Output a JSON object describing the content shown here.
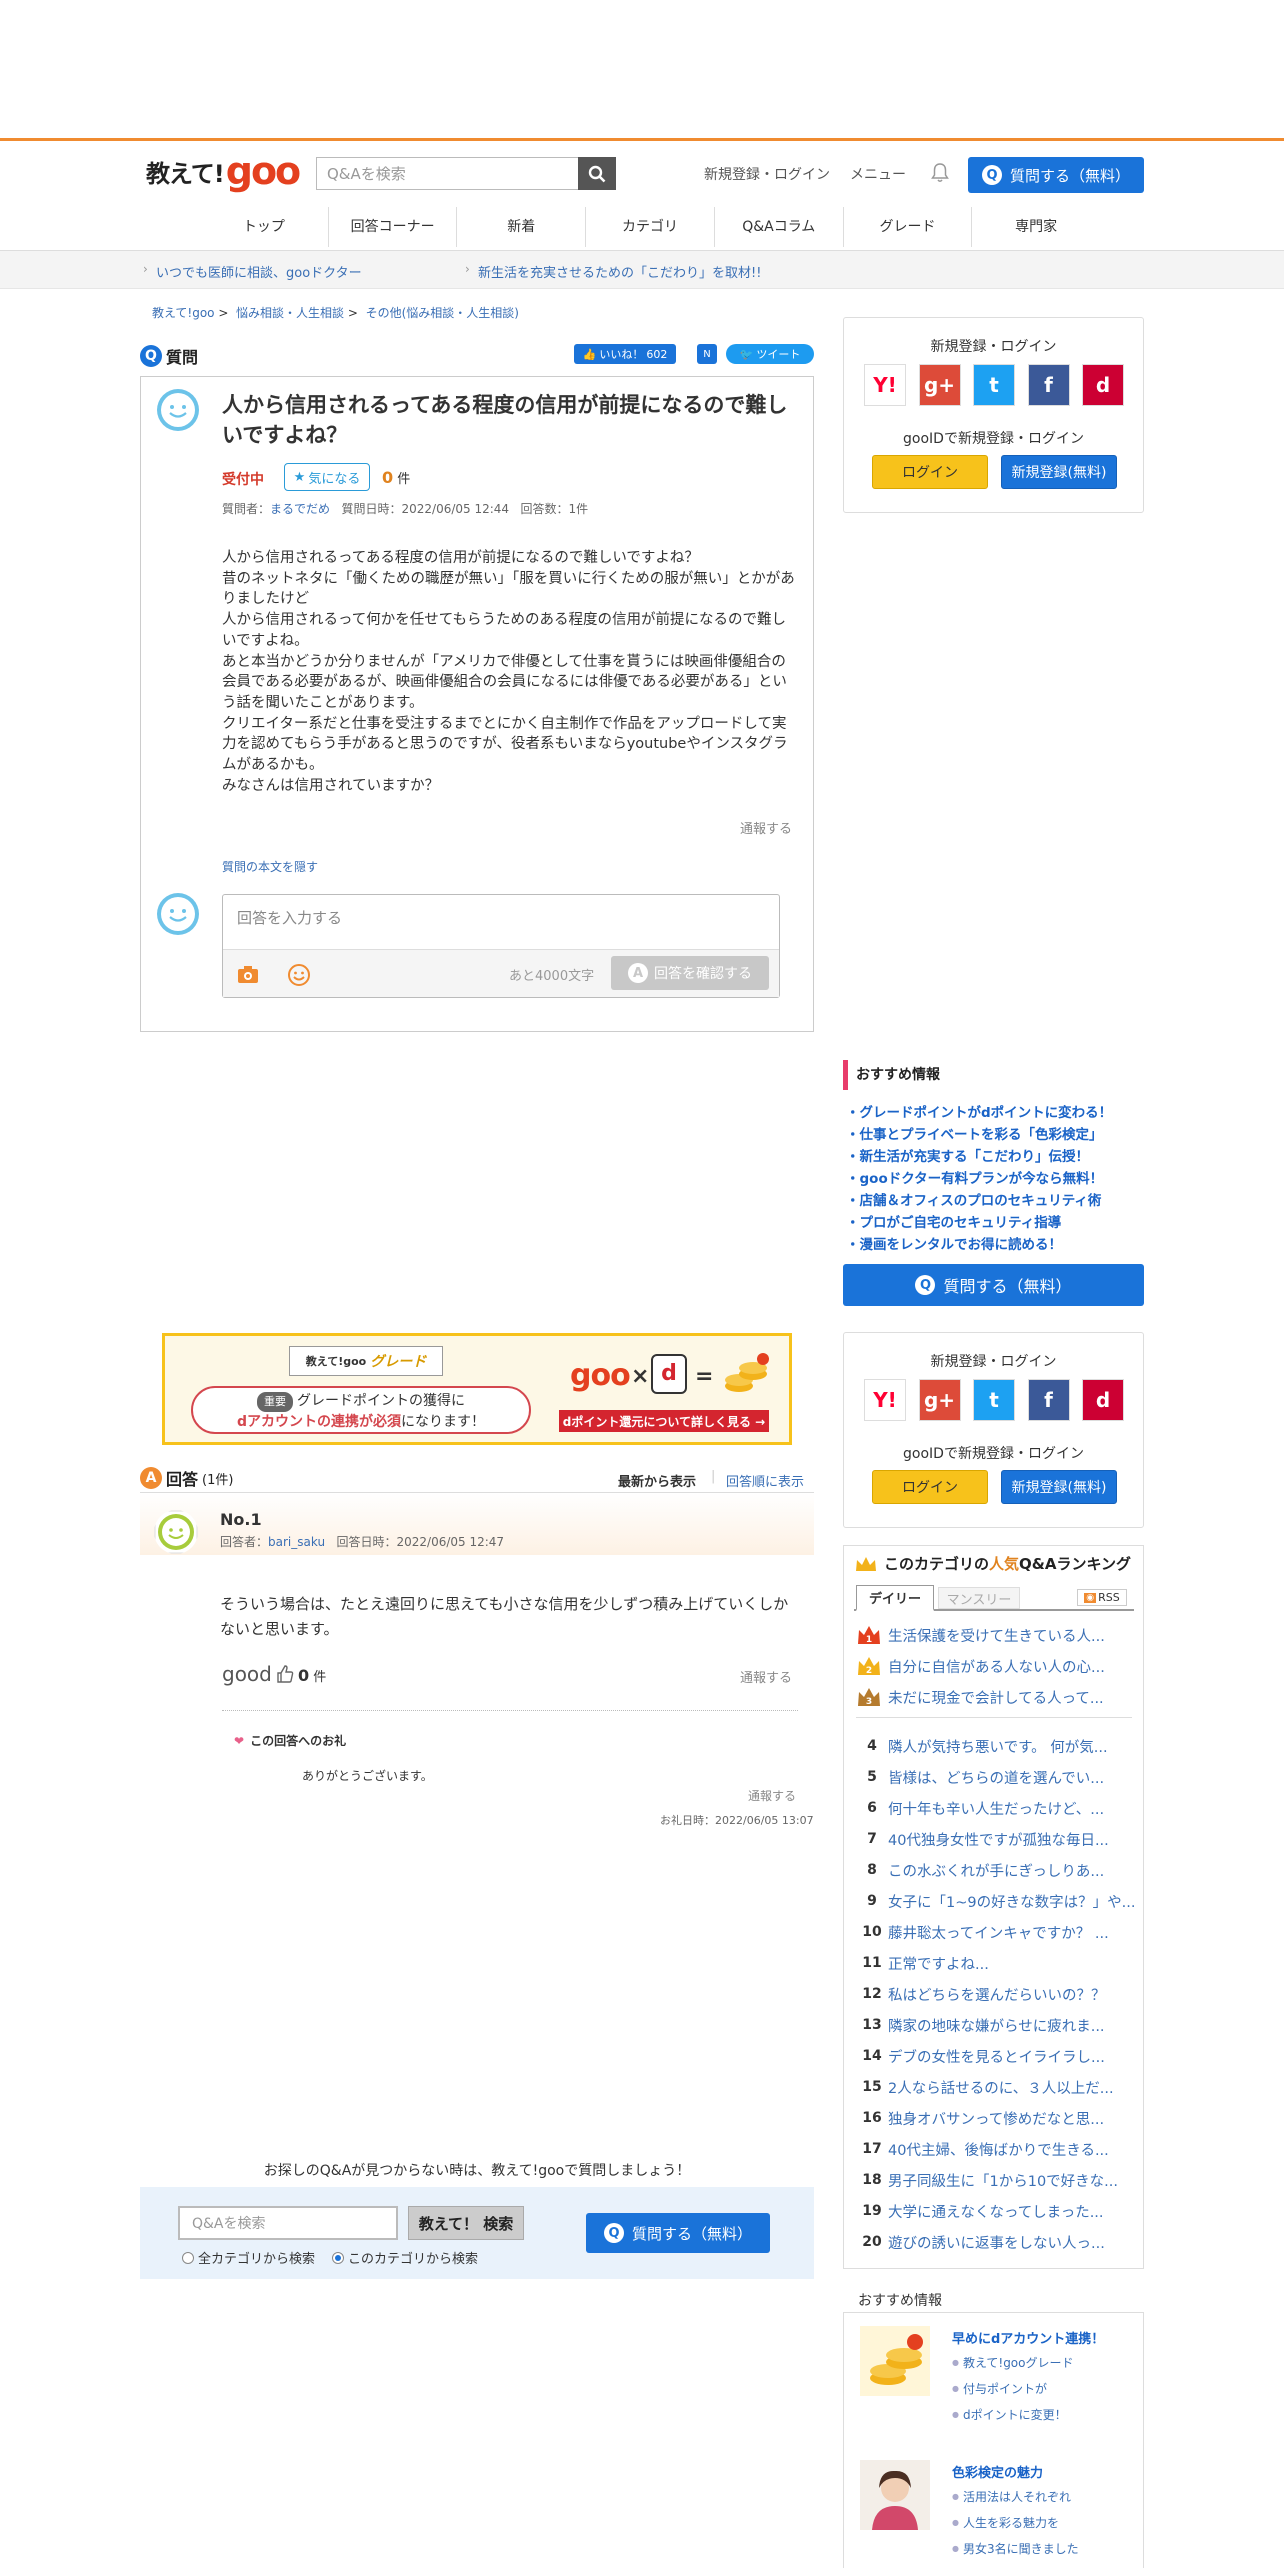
{
  "header": {
    "logo_text_1": "教えて!",
    "logo_text_2": "goo",
    "search_placeholder": "Q&Aを検索",
    "register_login": "新規登録・ログイン",
    "menu": "メニュー",
    "ask_button": "質問する（無料）",
    "ask_q": "Q"
  },
  "nav": {
    "items": [
      "トップ",
      "回答コーナー",
      "新着",
      "カテゴリ",
      "Q&Aコラム",
      "グレード",
      "専門家"
    ]
  },
  "subbar": {
    "link1": "いつでも医師に相談、gooドクター",
    "link2": "新生活を充実させるための「こだわり」を取材!!"
  },
  "breadcrumb": {
    "items": [
      "教えて!goo",
      "悩み相談・人生相談",
      "その他(悩み相談・人生相談)"
    ],
    "sep": ">"
  },
  "question": {
    "section_label": "質問",
    "like_label": "いいね！",
    "like_count": "602",
    "note_label": "N",
    "tweet_label": "ツイート",
    "title": "人から信用されるってある程度の信用が前提になるので難しいですよね？",
    "status": "受付中",
    "follow_label": "気になる",
    "count_value": "0",
    "count_unit": "件",
    "asker_label": "質問者：",
    "asker_name": "まるでだめ",
    "date_label": "質問日時：2022/06/05 12:44",
    "answers_label": "回答数：1件",
    "body": "人から信用されるってある程度の信用が前提になるので難しいですよね？\n昔のネットネタに「働くための職歴が無い」「服を買いに行くための服が無い」とかがありましたけど\n人から信用されるって何かを任せてもらうためのある程度の信用が前提になるので難しいですよね。\nあと本当かどうか分りませんが「アメリカで俳優として仕事を貰うには映画俳優組合の会員である必要があるが、映画俳優組合の会員になるには俳優である必要がある」という話を聞いたことがあります。\nクリエイター系だと仕事を受注するまでとにかく自主制作で作品をアップロードして実力を認めてもらう手があると思うのですが、役者系もいまならyoutubeやインスタグラムがあるかも。\nみなさんは信用されていますか？",
    "report": "通報する",
    "hide_body": "質問の本文を隠す",
    "answer_placeholder": "回答を入力する",
    "remaining": "あと4000文字",
    "confirm_button": "回答を確認する",
    "confirm_a": "A"
  },
  "sidebar": {
    "login_title": "新規登録・ログイン",
    "social": [
      {
        "label": "Y!",
        "color": "#ff0033"
      },
      {
        "label": "g+",
        "color": "#dd4b39"
      },
      {
        "label": "t",
        "color": "#1da1f2"
      },
      {
        "label": "f",
        "color": "#3b5998"
      },
      {
        "label": "d",
        "color": "#cc0033"
      }
    ],
    "gooid_text": "gooIDで新規登録・ログイン",
    "login_button": "ログイン",
    "register_button": "新規登録(無料)",
    "recommend_title": "おすすめ情報",
    "recommend": [
      "グレードポイントがdポイントに変わる！",
      "仕事とプライベートを彩る「色彩検定」",
      "新生活が充実する「こだわり」伝授！",
      "gooドクター有料プランが今なら無料！",
      "店舗＆オフィスのプロのセキュリティ術",
      "プロがご自宅のセキュリティ指導",
      "漫画をレンタルでお得に読める！"
    ],
    "recommend_bullet": "・",
    "ask_button": "質問する（無料）"
  },
  "grade_banner": {
    "title_prefix": "教えて!goo",
    "title_grade": "グレード",
    "tag": "重要",
    "msg_line1": "グレードポイントの獲得に",
    "msg_red": "dアカウントの連携が必須",
    "msg_tail": "になります！",
    "goo": "goo",
    "x": "×",
    "d": "d",
    "eq": "=",
    "link": "dポイント還元について詳しく見る →"
  },
  "answers": {
    "section_label": "回答",
    "count": "(1件)",
    "sort_new": "最新から表示",
    "sort_order": "回答順に表示",
    "items": [
      {
        "no": "No.1",
        "answerer_label": "回答者：",
        "answerer": "bari_saku",
        "date": "回答日時：2022/06/05 12:47",
        "body": "そういう場合は、たとえ遠回りに思えても小さな信用を少しずつ積み上げていくしかないと思います。",
        "good_label": "good",
        "good_count": "0",
        "good_unit": "件",
        "report": "通報する",
        "thanks_title": "この回答へのお礼",
        "thanks_body": "ありがとうございます。",
        "thanks_report": "通報する",
        "thanks_date": "お礼日時：2022/06/05 13:07"
      }
    ]
  },
  "bottom_search": {
    "message": "お探しのQ&Aが見つからない時は、教えて!gooで質問しましょう！",
    "placeholder": "Q&Aを検索",
    "button": "教えて！ 検索",
    "radio_all": "全カテゴリから検索",
    "radio_this": "このカテゴリから検索",
    "ask_button": "質問する（無料）"
  },
  "ranking": {
    "title_pre": "このカテゴリの",
    "title_em": "人気",
    "title_post": "Q&Aランキング",
    "tab_daily": "デイリー",
    "tab_monthly": "マンスリー",
    "rss": "RSS",
    "items": [
      {
        "rank": "1",
        "text": "生活保護を受けて生きている人..."
      },
      {
        "rank": "2",
        "text": "自分に自信がある人ない人の心..."
      },
      {
        "rank": "3",
        "text": "未だに現金で会計してる人って..."
      },
      {
        "rank": "4",
        "text": "隣人が気持ち悪いです。 何が気..."
      },
      {
        "rank": "5",
        "text": "皆様は、どちらの道を選んでい..."
      },
      {
        "rank": "6",
        "text": "何十年も辛い人生だったけど、..."
      },
      {
        "rank": "7",
        "text": "40代独身女性ですが孤独な毎日..."
      },
      {
        "rank": "8",
        "text": "この水ぶくれが手にぎっしりあ..."
      },
      {
        "rank": "9",
        "text": "女子に「1~9の好きな数字は？」や..."
      },
      {
        "rank": "10",
        "text": "藤井聡太ってインキャですか？ ..."
      },
      {
        "rank": "11",
        "text": "正常ですよね..."
      },
      {
        "rank": "12",
        "text": "私はどちらを選んだらいいの？？"
      },
      {
        "rank": "13",
        "text": "隣家の地味な嫌がらせに疲れま..."
      },
      {
        "rank": "14",
        "text": "デブの女性を見るとイライラし..."
      },
      {
        "rank": "15",
        "text": "2人なら話せるのに、３人以上だ..."
      },
      {
        "rank": "16",
        "text": "独身オバサンって惨めだなと思..."
      },
      {
        "rank": "17",
        "text": "40代主婦、後悔ばかりで生きる..."
      },
      {
        "rank": "18",
        "text": "男子同級生に「1から10で好きな..."
      },
      {
        "rank": "19",
        "text": "大学に通えなくなってしまった..."
      },
      {
        "rank": "20",
        "text": "遊びの誘いに返事をしない人っ..."
      }
    ]
  },
  "recommend2": {
    "title": "おすすめ情報",
    "block1_title": "早めにdアカウント連携！",
    "block1_lines": [
      "教えて!gooグレード",
      "付与ポイントが",
      "dポイントに変更！"
    ],
    "block2_title": "色彩検定の魅力",
    "block2_lines": [
      "活用法は人それぞれ",
      "人生を彩る魅力を",
      "男女3名に聞きました"
    ]
  },
  "colors": {
    "brand_orange": "#f08b30",
    "goo_red": "#e4401f",
    "primary_blue": "#1a73d9",
    "status_red": "#d43a2b"
  }
}
